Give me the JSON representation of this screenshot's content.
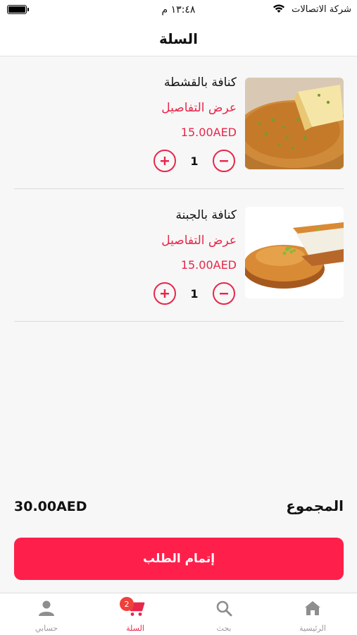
{
  "status_bar": {
    "time": "١٣:٤٨ م",
    "carrier": "شركة الاتصالات"
  },
  "header": {
    "title": "السلة"
  },
  "cart": {
    "items": [
      {
        "name": "كنافة بالقشطة",
        "details_label": "عرض التفاصيل",
        "price": "15.00AED",
        "quantity": "1"
      },
      {
        "name": "كنافة بالجبنة",
        "details_label": "عرض التفاصيل",
        "price": "15.00AED",
        "quantity": "1"
      }
    ]
  },
  "summary": {
    "total_label": "المجموع",
    "total_value": "30.00AED",
    "checkout_label": "إتمام الطلب"
  },
  "bottom_nav": {
    "items": [
      {
        "label": "الرئيسية",
        "icon": "home-icon"
      },
      {
        "label": "بحث",
        "icon": "search-icon"
      },
      {
        "label": "السلة",
        "icon": "cart-icon",
        "badge": "2"
      },
      {
        "label": "حسابي",
        "icon": "person-icon"
      }
    ],
    "active_index": 2
  },
  "colors": {
    "accent": "#e8264a",
    "checkout_button": "#ff1f4b",
    "badge": "#f0403a"
  }
}
